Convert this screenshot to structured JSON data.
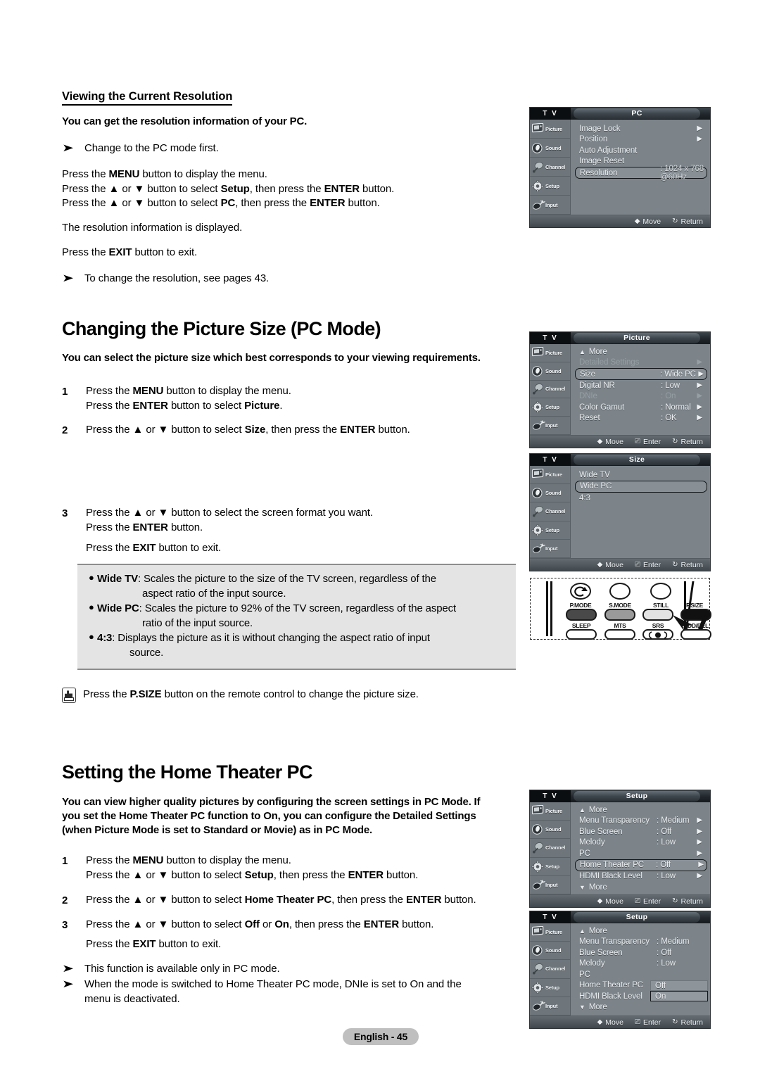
{
  "page": {
    "footer": "English - 45"
  },
  "section1": {
    "heading": "Viewing the Current Resolution",
    "lead": "You can get the resolution information of your PC.",
    "note1": "Change to the PC mode first.",
    "line1_a": "Press the ",
    "line1_b": "MENU",
    "line1_c": " button to display the menu.",
    "line2_a": "Press the ▲ or ▼ button to select ",
    "line2_b": "Setup",
    "line2_c": ", then press the ",
    "line2_d": "ENTER",
    "line2_e": " button.",
    "line3_a": "Press the ▲ or ▼ button to select ",
    "line3_b": "PC",
    "line3_c": ", then press the ",
    "line3_d": "ENTER",
    "line3_e": " button.",
    "line4": "The resolution information is displayed.",
    "line5_a": "Press the ",
    "line5_b": "EXIT",
    "line5_c": " button to exit.",
    "note2": "To change the resolution, see pages 43."
  },
  "section2": {
    "heading": "Changing the Picture Size (PC Mode)",
    "lead": "You can select the picture size which best corresponds to your viewing requirements.",
    "step1": {
      "index": "1",
      "l1_a": "Press the ",
      "l1_b": "MENU",
      "l1_c": " button to display the menu.",
      "l2_a": "Press the ",
      "l2_b": "ENTER",
      "l2_c": " button to select ",
      "l2_d": "Picture",
      "l2_e": "."
    },
    "step2": {
      "index": "2",
      "l1_a": "Press the ▲ or ▼ button to select ",
      "l1_b": "Size",
      "l1_c": ", then press the ",
      "l1_d": "ENTER",
      "l1_e": " button."
    },
    "step3": {
      "index": "3",
      "l1": "Press the ▲ or ▼ button to select the screen format you want.",
      "l2_a": "Press the ",
      "l2_b": "ENTER",
      "l2_c": " button.",
      "l3_a": "Press the ",
      "l3_b": "EXIT",
      "l3_c": " button to exit."
    },
    "infobox": {
      "item1_term": "Wide TV",
      "item1_text": ": Scales the picture to the size of the TV screen, regardless of the",
      "item1_cont": "aspect ratio of the input source.",
      "item2_term": "Wide PC",
      "item2_text": ": Scales the picture to 92% of the TV screen, regardless of the aspect",
      "item2_cont": "ratio of the input source.",
      "item3_term": "4:3",
      "item3_text": ": Displays the picture as it is without changing the aspect ratio of input",
      "item3_cont": "source."
    },
    "psize_note_a": "Press the ",
    "psize_note_b": "P.SIZE",
    "psize_note_c": " button on the remote control to change the picture size."
  },
  "section3": {
    "heading": "Setting the Home Theater PC",
    "lead_l1": "You can view higher quality pictures by configuring the screen settings in PC Mode. If",
    "lead_l2": "you set the Home Theater PC function to On, you can configure the Detailed Settings",
    "lead_l3": "(when Picture Mode is set to Standard or Movie) as in PC Mode.",
    "step1": {
      "index": "1",
      "l1_a": "Press the ",
      "l1_b": "MENU",
      "l1_c": " button to display the menu.",
      "l2_a": "Press the ▲ or ▼ button to select ",
      "l2_b": "Setup",
      "l2_c": ", then press the ",
      "l2_d": "ENTER",
      "l2_e": " button."
    },
    "step2": {
      "index": "2",
      "l1_a": "Press the ▲ or ▼ button to select ",
      "l1_b": "Home Theater PC",
      "l1_c": ", then press the ",
      "l1_d": "ENTER",
      "l1_e": " button."
    },
    "step3": {
      "index": "3",
      "l1_a": "Press the ▲ or ▼ button to select ",
      "l1_b": "Off",
      "l1_c": " or ",
      "l1_d": "On",
      "l1_e": ", then press the ",
      "l1_f": "ENTER",
      "l1_g": " button.",
      "l2_a": "Press the ",
      "l2_b": "EXIT",
      "l2_c": " button to exit."
    },
    "note1": "This function is available only in PC mode.",
    "note2_l1": "When the mode is switched to Home Theater PC mode, DNIe is set to On and the",
    "note2_l2": "menu is deactivated."
  },
  "osd_rail": {
    "tv_label": "T V",
    "items": [
      {
        "label": "Picture",
        "icon": "picture-icon"
      },
      {
        "label": "Sound",
        "icon": "sound-icon"
      },
      {
        "label": "Channel",
        "icon": "channel-icon"
      },
      {
        "label": "Setup",
        "icon": "setup-gear-icon"
      },
      {
        "label": "Input",
        "icon": "input-icon"
      }
    ]
  },
  "osd_footer": {
    "move": "Move",
    "enter": "Enter",
    "return": "Return"
  },
  "osd_pc": {
    "title": "PC",
    "rows": [
      {
        "label": "Image Lock",
        "value": "",
        "arrow": "▶",
        "state": "normal"
      },
      {
        "label": "Position",
        "value": "",
        "arrow": "▶",
        "state": "normal"
      },
      {
        "label": "Auto Adjustment",
        "value": "",
        "arrow": "",
        "state": "normal"
      },
      {
        "label": "Image Reset",
        "value": "",
        "arrow": "",
        "state": "normal"
      },
      {
        "label": "Resolution",
        "value": ": 1024 x 768 @60Hz",
        "arrow": "",
        "state": "selected"
      }
    ]
  },
  "osd_picture": {
    "title": "Picture",
    "more_top": "More",
    "rows": [
      {
        "label": "Detailed Settings",
        "value": "",
        "arrow": "▶",
        "state": "dim"
      },
      {
        "label": "Size",
        "value": ": Wide PC",
        "arrow": "▶",
        "state": "selected"
      },
      {
        "label": "Digital NR",
        "value": ": Low",
        "arrow": "▶",
        "state": "normal"
      },
      {
        "label": "DNIe",
        "value": ": On",
        "arrow": "▶",
        "state": "dim"
      },
      {
        "label": "Color Gamut",
        "value": ": Normal",
        "arrow": "▶",
        "state": "normal"
      },
      {
        "label": "Reset",
        "value": ": OK",
        "arrow": "▶",
        "state": "normal"
      }
    ]
  },
  "osd_size": {
    "title": "Size",
    "options": [
      {
        "label": "Wide TV",
        "state": "normal"
      },
      {
        "label": "Wide PC",
        "state": "selected"
      },
      {
        "label": "4:3",
        "state": "normal"
      }
    ]
  },
  "osd_setup_a": {
    "title": "Setup",
    "more_top": "More",
    "more_bottom": "More",
    "rows": [
      {
        "label": "Menu Transparency",
        "value": ": Medium",
        "arrow": "▶",
        "state": "normal"
      },
      {
        "label": "Blue Screen",
        "value": ": Off",
        "arrow": "▶",
        "state": "normal"
      },
      {
        "label": "Melody",
        "value": ": Low",
        "arrow": "▶",
        "state": "normal"
      },
      {
        "label": "PC",
        "value": "",
        "arrow": "▶",
        "state": "normal"
      },
      {
        "label": "Home Theater PC",
        "value": ": Off",
        "arrow": "▶",
        "state": "selected"
      },
      {
        "label": "HDMI Black Level",
        "value": ": Low",
        "arrow": "▶",
        "state": "normal"
      }
    ]
  },
  "osd_setup_b": {
    "title": "Setup",
    "more_top": "More",
    "more_bottom": "More",
    "rows": [
      {
        "label": "Menu Transparency",
        "value": ": Medium",
        "arrow": "",
        "state": "normal"
      },
      {
        "label": "Blue Screen",
        "value": ": Off",
        "arrow": "",
        "state": "normal"
      },
      {
        "label": "Melody",
        "value": ": Low",
        "arrow": "",
        "state": "normal"
      },
      {
        "label": "PC",
        "value": "",
        "arrow": "",
        "state": "normal"
      },
      {
        "label": "Home Theater PC",
        "value": "",
        "arrow": "",
        "state": "normal"
      },
      {
        "label": "HDMI Black Level",
        "value": "",
        "arrow": "",
        "state": "normal"
      }
    ],
    "dropdown": [
      {
        "label": "Off",
        "state": "normal"
      },
      {
        "label": "On",
        "state": "selected"
      }
    ]
  },
  "remote": {
    "top_labels": [
      "P.MODE",
      "S.MODE",
      "STILL",
      "P.SIZE"
    ],
    "bottom_labels": [
      "SLEEP",
      "MTS",
      "SRS",
      "ADD/DEL"
    ]
  }
}
